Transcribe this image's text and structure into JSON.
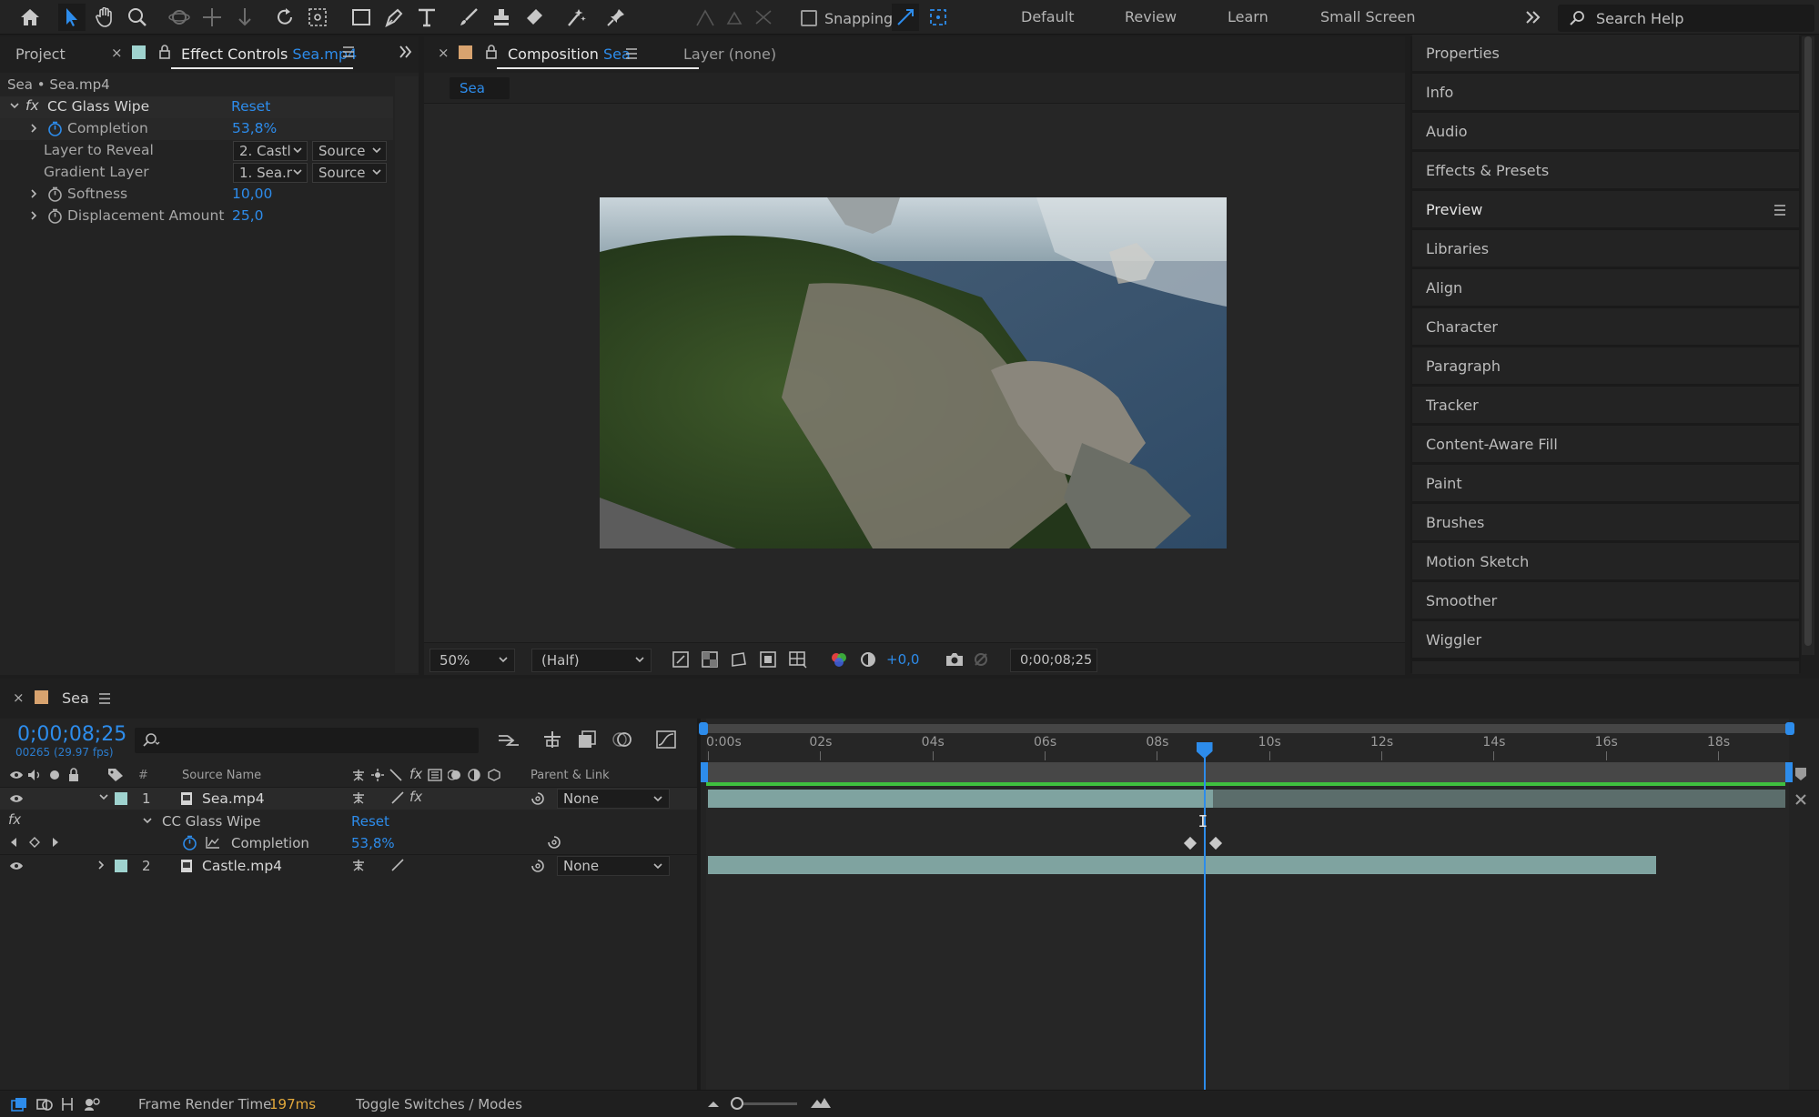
{
  "toolbar": {
    "snapping_label": "Snapping",
    "workspaces": [
      "Default",
      "Review",
      "Learn",
      "Small Screen"
    ],
    "search_placeholder": "Search Help"
  },
  "left_panel": {
    "tab_project": "Project",
    "tab_effect_controls": "Effect Controls",
    "tab_effect_controls_file": "Sea.mp4",
    "breadcrumb": "Sea • Sea.mp4",
    "effect_name": "CC Glass Wipe",
    "effect_reset": "Reset",
    "props": [
      {
        "label": "Completion",
        "value": "53,8%"
      },
      {
        "label": "Layer to Reveal",
        "value": "2. Castl…",
        "source": "Source"
      },
      {
        "label": "Gradient Layer",
        "value": "1. Sea.m…",
        "source": "Source"
      },
      {
        "label": "Softness",
        "value": "10,00"
      },
      {
        "label": "Displacement Amount",
        "value": "25,0"
      }
    ]
  },
  "comp_panel": {
    "tab_composition": "Composition",
    "tab_composition_name": "Sea",
    "tab_layer": "Layer (none)",
    "subtab": "Sea",
    "zoom": "50%",
    "resolution": "(Half)",
    "exposure": "+0,0",
    "timecode": "0;00;08;25"
  },
  "right_panel": {
    "items": [
      "Properties",
      "Info",
      "Audio",
      "Effects & Presets",
      "Preview",
      "Libraries",
      "Align",
      "Character",
      "Paragraph",
      "Tracker",
      "Content-Aware Fill",
      "Paint",
      "Brushes",
      "Motion Sketch",
      "Smoother",
      "Wiggler"
    ]
  },
  "timeline": {
    "comp_name": "Sea",
    "timecode": "0;00;08;25",
    "frame_info": "00265 (29.97 fps)",
    "col_hash": "#",
    "col_source_name": "Source Name",
    "col_parent": "Parent & Link",
    "ruler_ticks": [
      "0:00s",
      "02s",
      "04s",
      "06s",
      "08s",
      "10s",
      "12s",
      "14s",
      "16s",
      "18s"
    ],
    "playhead_seconds": 8.83,
    "duration_seconds": 19.2,
    "layers": [
      {
        "num": "1",
        "name": "Sea.mp4",
        "parent": "None",
        "start_s": 0,
        "end_s": 19.2,
        "highlight_end_s": 9.0
      },
      {
        "num": "2",
        "name": "Castle.mp4",
        "parent": "None",
        "start_s": 0,
        "end_s": 16.9
      }
    ],
    "effect_row": {
      "name": "CC Glass Wipe",
      "reset": "Reset"
    },
    "completion_row": {
      "label": "Completion",
      "value": "53,8%"
    },
    "keyframes_s": [
      8.6,
      9.05
    ]
  },
  "status": {
    "frame_render_label": "Frame Render Time",
    "frame_render_value": "197ms",
    "toggle_label": "Toggle Switches / Modes"
  },
  "colors": {
    "accent": "#2d8ceb",
    "bar_teal": "#7fa3a0",
    "work_area_green": "#3fbf3f",
    "render_time": "#e2a83b"
  }
}
